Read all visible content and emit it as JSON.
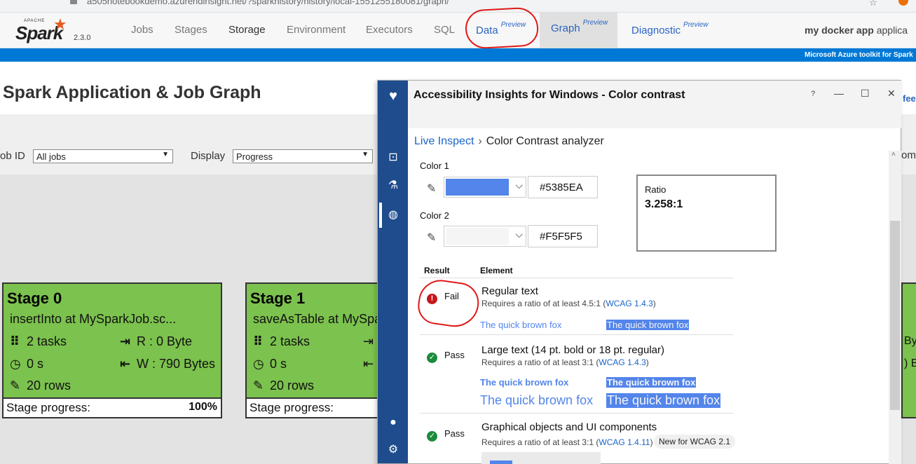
{
  "browser": {
    "url": "a505notebookdemo.azurehdinsight.net/?sparkhistory/history/local-1551255180081/graph/"
  },
  "spark": {
    "logo_small": "APACHE",
    "logo": "Spark",
    "version": "2.3.0",
    "nav": {
      "jobs": "Jobs",
      "stages": "Stages",
      "storage": "Storage",
      "environment": "Environment",
      "executors": "Executors",
      "sql": "SQL",
      "data": "Data",
      "graph": "Graph",
      "diagnostic": "Diagnostic",
      "preview": "Preview"
    },
    "app_name": "my docker app",
    "app_name_rest": " applica",
    "azure_toolkit": "Microsoft Azure toolkit for Spark",
    "page_title": "Spark Application & Job Graph",
    "feedback": "fee",
    "job_id_label": "ob ID",
    "job_id_value": "All jobs",
    "display_label": "Display",
    "display_value": "Progress",
    "zoom_label": "om"
  },
  "stages": [
    {
      "title": "Stage 0",
      "subtitle": "insertInto at MySparkJob.sc...",
      "tasks": "2 tasks",
      "time": "0 s",
      "rows": "20 rows",
      "read": "R : 0 Byte",
      "write": "W : 790 Bytes",
      "progress_label": "Stage progress:",
      "progress_value": "100%"
    },
    {
      "title": "Stage 1",
      "subtitle": "saveAsTable at MySpa",
      "tasks": "2 tasks",
      "time": "0 s",
      "rows": "20 rows",
      "progress_label": "Stage progress:"
    }
  ],
  "right_stage": {
    "line1": "By",
    "line2": ") By"
  },
  "accessibility": {
    "title": "Accessibility Insights for Windows - Color contrast",
    "breadcrumb_link": "Live Inspect",
    "breadcrumb_current": "Color Contrast analyzer",
    "color1_label": "Color 1",
    "color1_hex": "#5385EA",
    "color2_label": "Color 2",
    "color2_hex": "#F5F5F5",
    "ratio_label": "Ratio",
    "ratio_value": "3.258:1",
    "result_header": "Result",
    "element_header": "Element",
    "sample_text": "The quick brown fox",
    "results": [
      {
        "status": "Fail",
        "title": "Regular text",
        "requirement": "Requires a ratio of at least 4.5:1 (",
        "wcag": "WCAG 1.4.3",
        "close": ")"
      },
      {
        "status": "Pass",
        "title": "Large text (14 pt. bold or 18 pt. regular)",
        "requirement": "Requires a ratio of at least 3:1 (",
        "wcag": "WCAG 1.4.3",
        "close": ")"
      },
      {
        "status": "Pass",
        "title": "Graphical objects and UI components",
        "requirement": "Requires a ratio of at least 3:1 (",
        "wcag": "WCAG 1.4.11",
        "close": ")",
        "badge": "New for WCAG 2.1"
      }
    ]
  },
  "colors": {
    "fg": "#5385EA",
    "bg": "#F5F5F5",
    "stage_green": "#7cc24e",
    "rail": "#1e4c8c",
    "azure_bar": "#0079d6"
  }
}
